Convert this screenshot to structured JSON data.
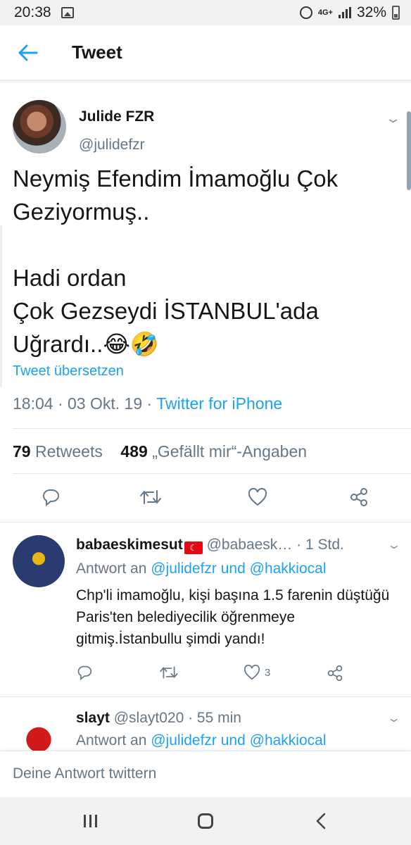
{
  "status_bar": {
    "time": "20:38",
    "network": "4G+",
    "battery": "32%"
  },
  "app_bar": {
    "back_icon": "arrow-left-icon",
    "title": "Tweet"
  },
  "main_tweet": {
    "display_name": "Julide FZR",
    "handle": "@julidefzr",
    "text": "Neymiş Efendim İmamoğlu Çok Geziyormuş..\n\nHadi  ordan\nÇok Gezseydi İSTANBUL'ada Uğrardı..😂🤣",
    "translate_link": "Tweet übersetzen",
    "time": "18:04",
    "date": "03 Okt. 19",
    "separator": "·",
    "source": "Twitter for iPhone",
    "retweets_count": "79",
    "retweets_label": "Retweets",
    "likes_count": "489",
    "likes_label": "„Gefällt mir“-Angaben"
  },
  "replies": [
    {
      "username": "babaeskimesut",
      "handle_time": "@babaesk… · 1 Std.",
      "reply_to_prefix": "Antwort an",
      "reply_to_users": "@julidefzr und @hakkiocal",
      "text": "Chp'li imamoğlu, kişi başına 1.5 farenin düştüğü Paris'ten belediyecilik öğrenmeye gitmiş.İstanbullu şimdi yandı!",
      "like_count": "3"
    },
    {
      "username": "slayt",
      "handle_time": "@slayt020 · 55 min",
      "reply_to_prefix": "Antwort an",
      "reply_to_users": "@julidefzr und @hakkiocal"
    }
  ],
  "compose": {
    "placeholder": "Deine Antwort twittern"
  },
  "colors": {
    "accent": "#1da1f2",
    "secondary_text": "#657786",
    "primary_text": "#14171a"
  }
}
